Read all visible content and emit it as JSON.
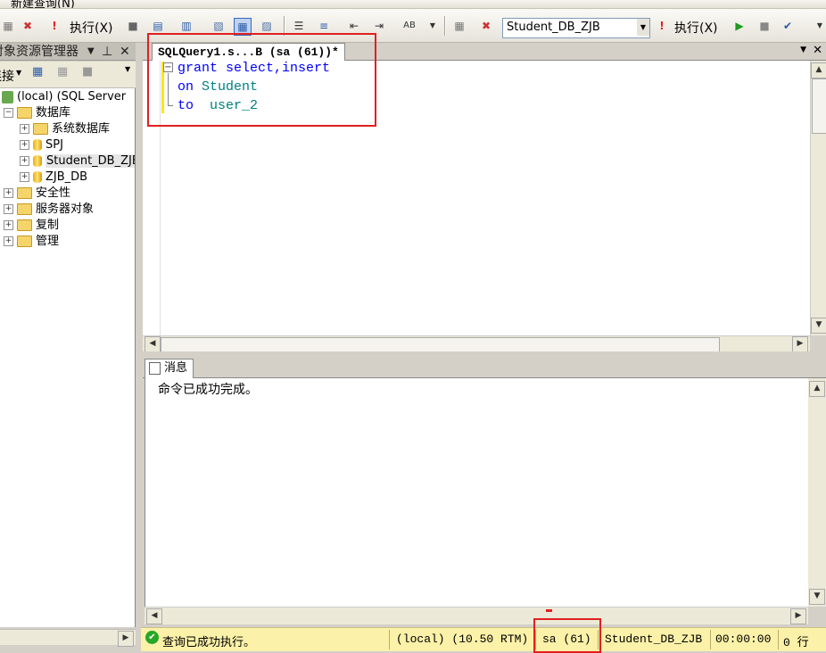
{
  "toolbar": {
    "menu_partial": "新建查询(N)",
    "execute_label_1": "执行(X)",
    "database_select": "Student_DB_ZJB",
    "execute_label_2": "执行(X)"
  },
  "object_explorer": {
    "title": "对象资源管理器",
    "connect_label": "连接",
    "server": "(local) (SQL Server",
    "tree": [
      {
        "label": "数据库",
        "expanded": true,
        "icon": "folder-icon"
      },
      {
        "label": "系统数据库",
        "expanded": false,
        "icon": "folder-icon"
      },
      {
        "label": "SPJ",
        "expanded": false,
        "icon": "database-icon"
      },
      {
        "label": "Student_DB_ZJB",
        "expanded": false,
        "icon": "database-icon",
        "selected": true
      },
      {
        "label": "ZJB_DB",
        "expanded": false,
        "icon": "database-icon"
      },
      {
        "label": "安全性",
        "expanded": false,
        "icon": "folder-icon"
      },
      {
        "label": "服务器对象",
        "expanded": false,
        "icon": "folder-icon"
      },
      {
        "label": "复制",
        "expanded": false,
        "icon": "folder-icon"
      },
      {
        "label": "管理",
        "expanded": false,
        "icon": "folder-icon"
      }
    ]
  },
  "editor": {
    "tab_title": "SQLQuery1.s...B (sa (61))*",
    "lines": [
      {
        "kw": "grant",
        "rest": " select,insert",
        "rest_class": "kw"
      },
      {
        "kw": "on",
        "rest": " Student",
        "rest_class": "ident"
      },
      {
        "kw": "to",
        "rest": "  user_2",
        "rest_class": "ident"
      }
    ]
  },
  "results": {
    "tab_label": "消息",
    "message": "命令已成功完成。"
  },
  "statusbar": {
    "status": "查询已成功执行。",
    "server": "(local) (10.50 RTM)",
    "user": "sa (61)",
    "database": "Student_DB_ZJB",
    "elapsed": "00:00:00",
    "rows": "0 行"
  },
  "colors": {
    "keyword": "#0000ff",
    "identifier": "#008080",
    "highlight": "#e02020",
    "statusbar": "#fbf1a8"
  }
}
